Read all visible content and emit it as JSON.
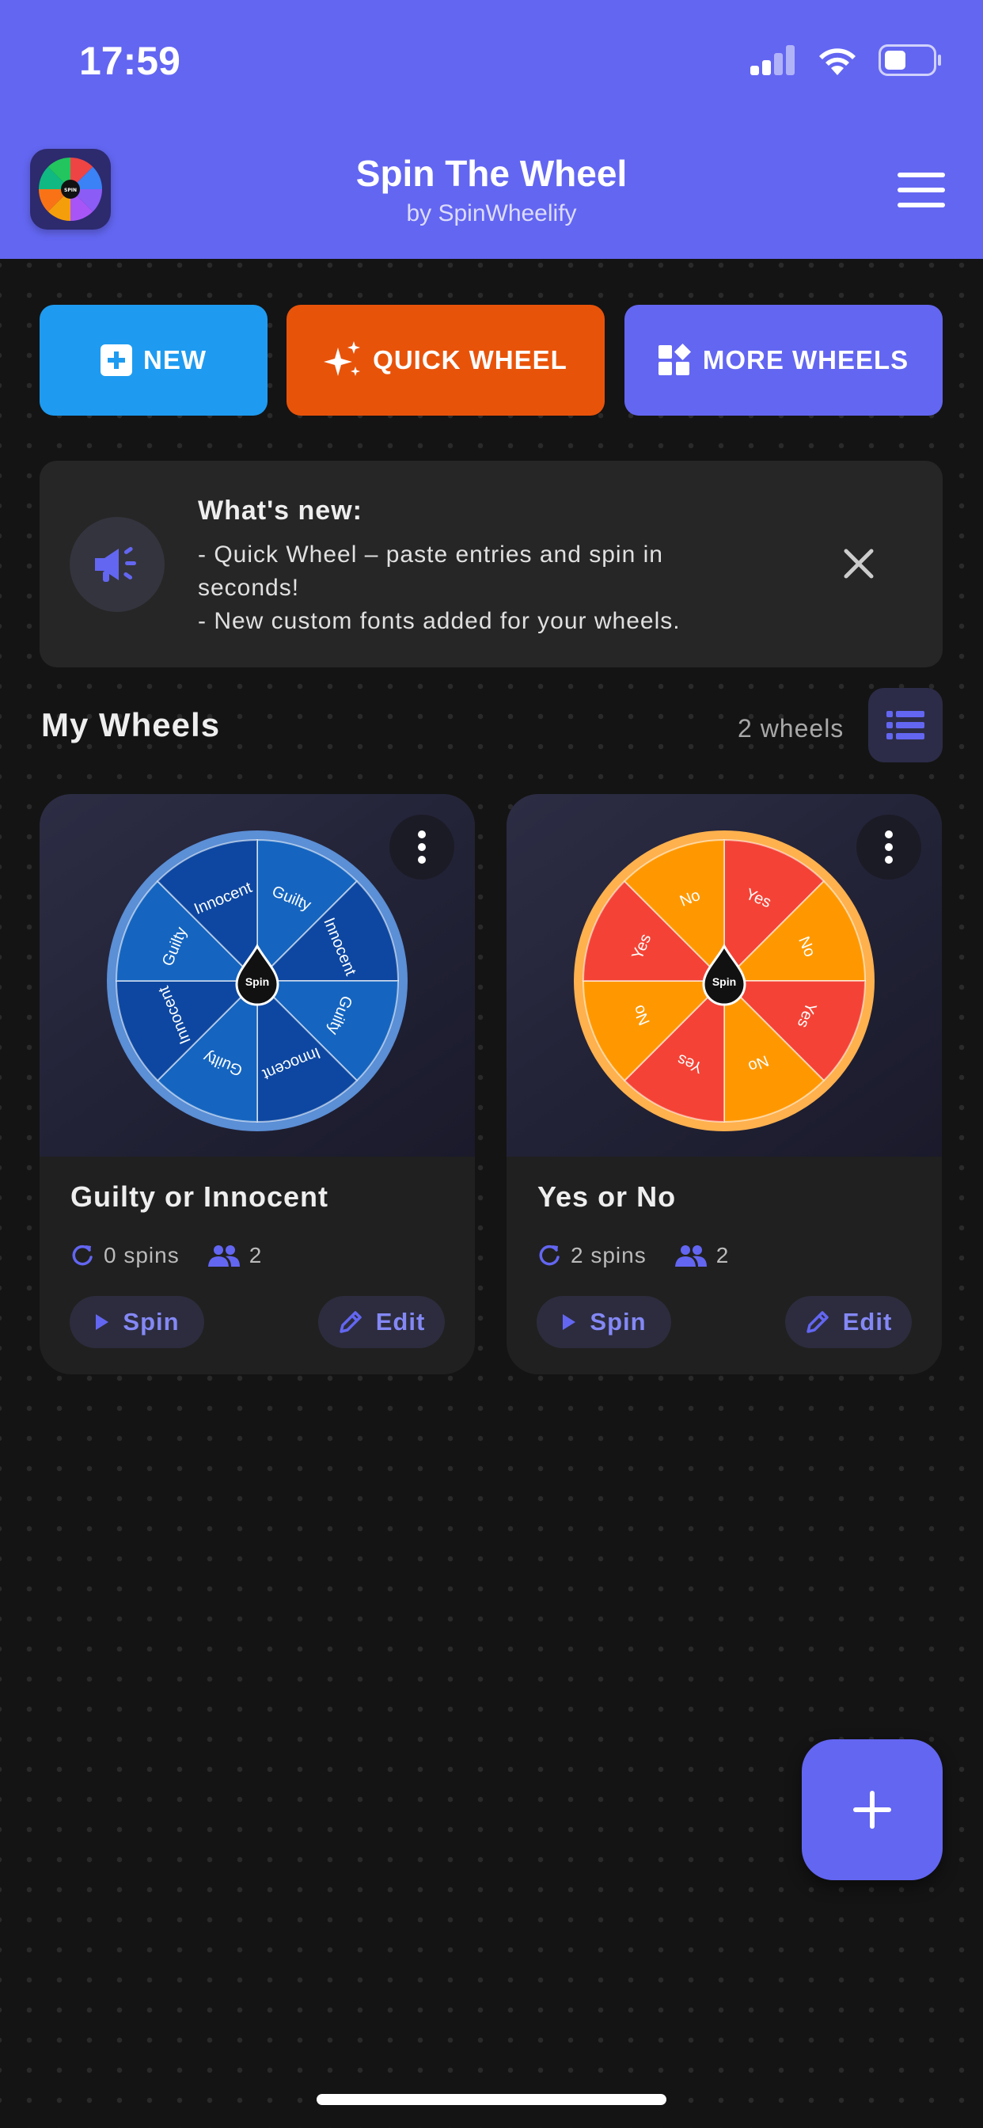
{
  "status_bar": {
    "time": "17:59"
  },
  "app": {
    "logo_label": "SPIN",
    "title": "Spin The Wheel",
    "subtitle": "by SpinWheelify"
  },
  "actions": {
    "new_label": "NEW",
    "quick_label": "QUICK WHEEL",
    "more_label": "MORE WHEELS"
  },
  "whats_new": {
    "title": "What's new:",
    "lines": [
      "- Quick Wheel – paste entries and spin in",
      "seconds!",
      "- New custom fonts added for your wheels."
    ]
  },
  "my_wheels": {
    "title": "My Wheels",
    "count_label": "2 wheels",
    "wheels": [
      {
        "name": "Guilty or Innocent",
        "spins_label": "0 spins",
        "participants": "2",
        "spin_label": "Spin",
        "edit_label": "Edit",
        "center_label": "Spin",
        "segments": [
          "Guilty",
          "Innocent",
          "Guilty",
          "Innocent",
          "Guilty",
          "Innocent",
          "Guilty",
          "Innocent"
        ],
        "colors": [
          "#1565c0",
          "#0d47a1"
        ],
        "rim_color": "#5b8fd6"
      },
      {
        "name": "Yes or No",
        "spins_label": "2 spins",
        "participants": "2",
        "spin_label": "Spin",
        "edit_label": "Edit",
        "center_label": "Spin",
        "segments": [
          "Yes",
          "No",
          "Yes",
          "No",
          "Yes",
          "No",
          "Yes",
          "No"
        ],
        "colors": [
          "#f44336",
          "#ff9800"
        ],
        "rim_color": "#ffb14e"
      }
    ]
  },
  "colors": {
    "header": "#6366f1",
    "new": "#1e9bf0",
    "quick": "#e8530a",
    "more": "#6366f1",
    "accent": "#8488f5"
  },
  "icons": {
    "megaphone": "megaphone-icon",
    "close": "close-icon",
    "list": "list-view-icon",
    "refresh": "refresh-icon",
    "people": "people-icon",
    "play": "play-icon",
    "pencil": "pencil-icon",
    "plus": "plus-icon",
    "more": "more-vertical-icon"
  }
}
